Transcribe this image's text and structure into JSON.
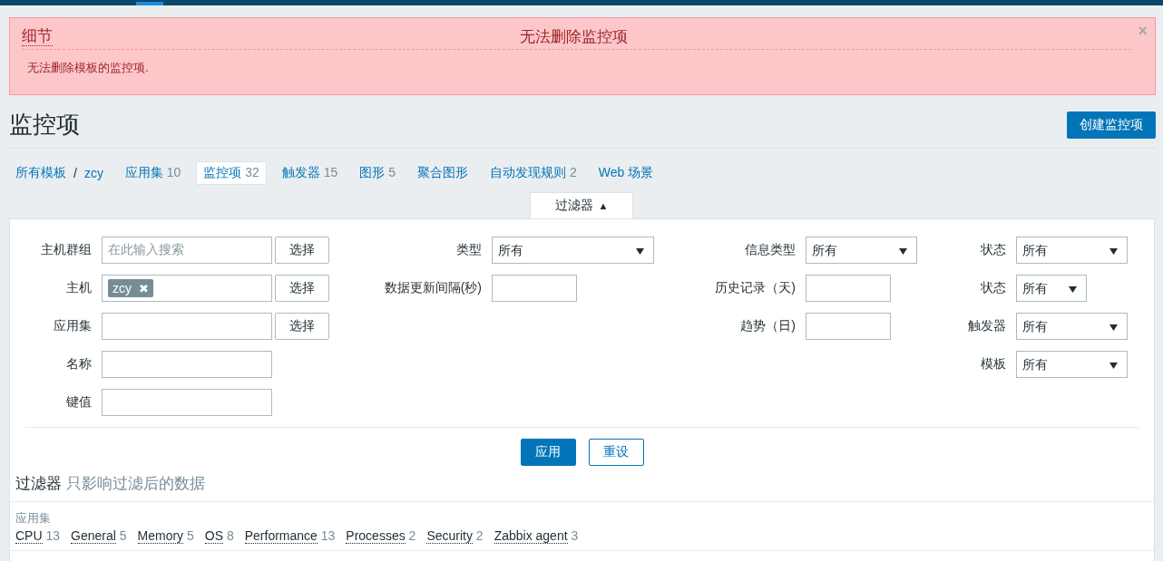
{
  "error_box": {
    "details_label": "细节",
    "title": "无法删除监控项",
    "close": "×",
    "message": "无法删除模板的监控项."
  },
  "page": {
    "title": "监控项",
    "create_button": "创建监控项"
  },
  "breadcrumb": {
    "root": "所有模板",
    "separator": "/",
    "host": "zcy"
  },
  "tabs": [
    {
      "label": "应用集",
      "count": "10",
      "selected": false
    },
    {
      "label": "监控项",
      "count": "32",
      "selected": true
    },
    {
      "label": "触发器",
      "count": "15",
      "selected": false
    },
    {
      "label": "图形",
      "count": "5",
      "selected": false
    },
    {
      "label": "聚合图形",
      "selected": false
    },
    {
      "label": "自动发现规则",
      "count": "2",
      "selected": false
    },
    {
      "label": "Web 场景",
      "selected": false
    }
  ],
  "filter": {
    "tab_label": "过滤器",
    "tab_arrow": "▲",
    "columns": [
      [
        {
          "label": "主机群组",
          "kind": "multiselect",
          "placeholder": "在此输入搜索",
          "button": "选择"
        },
        {
          "label": "主机",
          "kind": "multiselect",
          "chips": [
            {
              "text": "zcy",
              "remove": "✖"
            }
          ],
          "button": "选择"
        },
        {
          "label": "应用集",
          "kind": "multiselect",
          "button": "选择"
        },
        {
          "label": "名称",
          "kind": "text"
        },
        {
          "label": "键值",
          "kind": "text"
        }
      ],
      [
        {
          "label": "类型",
          "kind": "select",
          "value": "所有"
        },
        {
          "label": "数据更新间隔(秒)",
          "kind": "text"
        }
      ],
      [
        {
          "label": "信息类型",
          "kind": "select",
          "value": "所有"
        },
        {
          "label": "历史记录（天)",
          "kind": "text"
        },
        {
          "label": "趋势（日)",
          "kind": "text"
        }
      ],
      [
        {
          "label": "状态",
          "kind": "select",
          "value": "所有"
        },
        {
          "label": "状态",
          "kind": "select",
          "value": "所有"
        },
        {
          "label": "触发器",
          "kind": "select",
          "value": "所有"
        },
        {
          "label": "模板",
          "kind": "select",
          "value": "所有"
        }
      ]
    ],
    "apply_button": "应用",
    "reset_button": "重设"
  },
  "subfilter": {
    "title": "过滤器",
    "note": "只影响过滤后的数据",
    "groups": [
      {
        "label": "应用集",
        "items": [
          {
            "name": "CPU",
            "count": "13"
          },
          {
            "name": "General",
            "count": "5"
          },
          {
            "name": "Memory",
            "count": "5"
          },
          {
            "name": "OS",
            "count": "8"
          },
          {
            "name": "Performance",
            "count": "13"
          },
          {
            "name": "Processes",
            "count": "2"
          },
          {
            "name": "Security",
            "count": "2"
          },
          {
            "name": "Zabbix agent",
            "count": "3"
          }
        ]
      }
    ]
  }
}
